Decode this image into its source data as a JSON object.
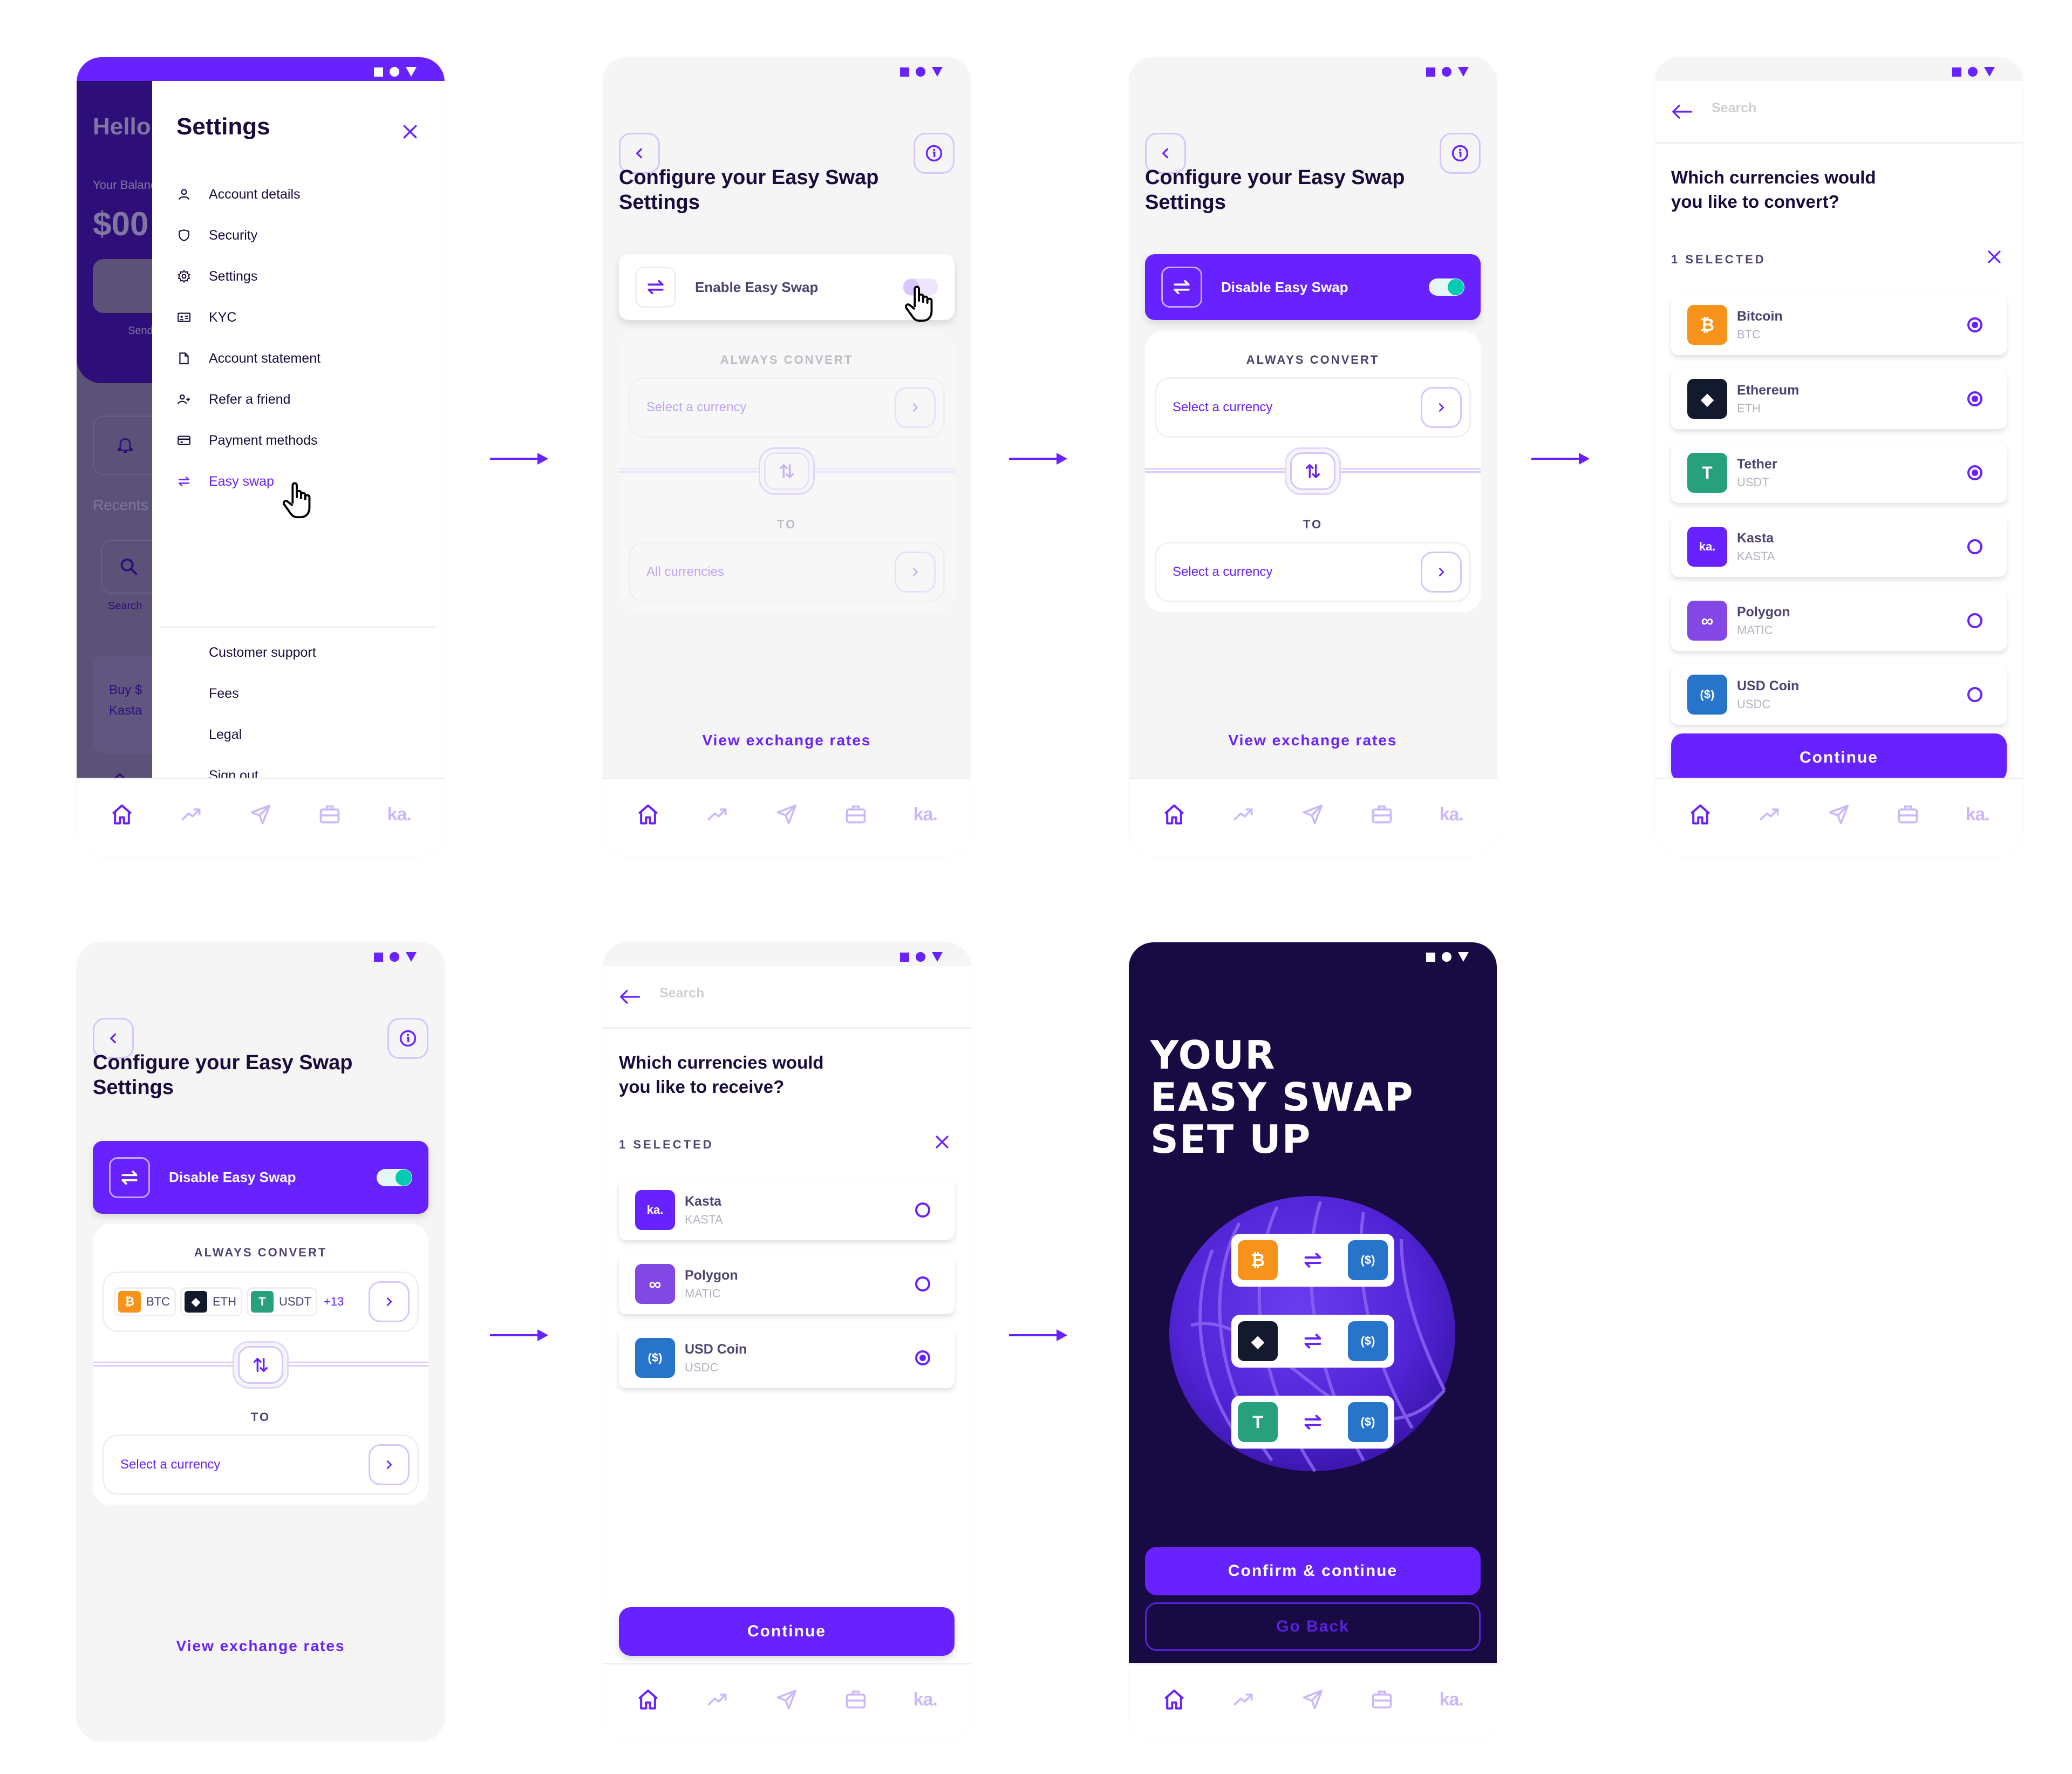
{
  "colors": {
    "primary": "#6821ff",
    "dark": "#1a0b3d",
    "dark_bg": "#180a42",
    "toggle_on": "#00cbb1",
    "btc": "#f7931a",
    "eth": "#141a2e",
    "usdt": "#26a17b",
    "kasta": "#6821ff",
    "matic": "#8247e5",
    "usdc": "#2775ca"
  },
  "nav": {
    "items": [
      {
        "name": "home",
        "icon": "home-icon",
        "active": true
      },
      {
        "name": "markets",
        "icon": "trending-icon",
        "active": false
      },
      {
        "name": "send",
        "icon": "send-icon",
        "active": false
      },
      {
        "name": "portfolio",
        "icon": "briefcase-icon",
        "active": false
      },
      {
        "name": "kasta",
        "label": "ka.",
        "active": false
      }
    ]
  },
  "screen1": {
    "background": {
      "greeting": "Hello",
      "balance_label": "Your Balance",
      "balance": "$00",
      "send_label": "Send",
      "recents_label": "Recents",
      "search_label": "Search",
      "promo_line1": "Buy $",
      "promo_line2": "Kasta"
    },
    "title": "Settings",
    "menu": [
      {
        "label": "Account details",
        "icon": "user-icon"
      },
      {
        "label": "Security",
        "icon": "shield-icon"
      },
      {
        "label": "Settings",
        "icon": "gear-icon"
      },
      {
        "label": "KYC",
        "icon": "id-card-icon"
      },
      {
        "label": "Account statement",
        "icon": "document-icon"
      },
      {
        "label": "Refer a friend",
        "icon": "user-plus-icon"
      },
      {
        "label": "Payment methods",
        "icon": "credit-card-icon"
      },
      {
        "label": "Easy swap",
        "icon": "swap-icon",
        "active": true
      }
    ],
    "secondary_menu": [
      "Customer support",
      "Fees",
      "Legal",
      "Sign out"
    ],
    "social": [
      "facebook-icon",
      "twitter-icon",
      "instagram-icon"
    ]
  },
  "screen2": {
    "title": "Configure your Easy Swap Settings",
    "toggle_label": "Enable Easy Swap",
    "toggle_on": false,
    "always_convert": "ALWAYS CONVERT",
    "from_placeholder": "Select a currency",
    "to_label": "TO",
    "to_value": "All currencies",
    "view_rates": "View exchange rates"
  },
  "screen3": {
    "title": "Configure your Easy Swap Settings",
    "toggle_label": "Disable Easy Swap",
    "toggle_on": true,
    "always_convert": "ALWAYS CONVERT",
    "from_placeholder": "Select a currency",
    "to_label": "TO",
    "to_placeholder": "Select a currency",
    "view_rates": "View exchange rates"
  },
  "screen4": {
    "search_placeholder": "Search",
    "title_line1": "Which currencies would",
    "title_line2": "you like to convert?",
    "selected_label": "1 SELECTED",
    "coins": [
      {
        "name": "Bitcoin",
        "symbol": "BTC",
        "glyph": "₿",
        "color": "#f7931a",
        "checked": true
      },
      {
        "name": "Ethereum",
        "symbol": "ETH",
        "glyph": "◆",
        "color": "#141a2e",
        "checked": true
      },
      {
        "name": "Tether",
        "symbol": "USDT",
        "glyph": "T",
        "color": "#26a17b",
        "checked": true
      },
      {
        "name": "Kasta",
        "symbol": "KASTA",
        "glyph": "ka.",
        "color": "#6821ff",
        "checked": false
      },
      {
        "name": "Polygon",
        "symbol": "MATIC",
        "glyph": "∞",
        "color": "#8247e5",
        "checked": false
      },
      {
        "name": "USD Coin",
        "symbol": "USDC",
        "glyph": "($)",
        "color": "#2775ca",
        "checked": false
      }
    ],
    "continue": "Continue"
  },
  "screen5": {
    "title": "Configure your Easy Swap Settings",
    "toggle_label": "Disable Easy Swap",
    "toggle_on": true,
    "always_convert": "ALWAYS CONVERT",
    "chips": [
      {
        "symbol": "BTC",
        "glyph": "₿",
        "color": "#f7931a"
      },
      {
        "symbol": "ETH",
        "glyph": "◆",
        "color": "#141a2e"
      },
      {
        "symbol": "USDT",
        "glyph": "T",
        "color": "#26a17b"
      }
    ],
    "more_count": "+13",
    "to_label": "TO",
    "to_placeholder": "Select a currency",
    "view_rates": "View exchange rates"
  },
  "screen6": {
    "search_placeholder": "Search",
    "title_line1": "Which currencies would",
    "title_line2": "you like to receive?",
    "selected_label": "1 SELECTED",
    "coins": [
      {
        "name": "Kasta",
        "symbol": "KASTA",
        "glyph": "ka.",
        "color": "#6821ff",
        "checked": false
      },
      {
        "name": "Polygon",
        "symbol": "MATIC",
        "glyph": "∞",
        "color": "#8247e5",
        "checked": false
      },
      {
        "name": "USD Coin",
        "symbol": "USDC",
        "glyph": "($)",
        "color": "#2775ca",
        "checked": true
      }
    ],
    "continue": "Continue"
  },
  "screen7": {
    "title_line1": "YOUR",
    "title_line2": "EASY SWAP",
    "title_line3": "SET UP",
    "pairs": [
      {
        "from": "BTC",
        "from_glyph": "₿",
        "from_color": "#f7931a",
        "to": "USDC",
        "to_glyph": "($)",
        "to_color": "#2775ca"
      },
      {
        "from": "ETH",
        "from_glyph": "◆",
        "from_color": "#141a2e",
        "to": "USDC",
        "to_glyph": "($)",
        "to_color": "#2775ca"
      },
      {
        "from": "USDT",
        "from_glyph": "T",
        "from_color": "#26a17b",
        "to": "USDC",
        "to_glyph": "($)",
        "to_color": "#2775ca"
      }
    ],
    "confirm": "Confirm & continue",
    "go_back": "Go Back"
  }
}
